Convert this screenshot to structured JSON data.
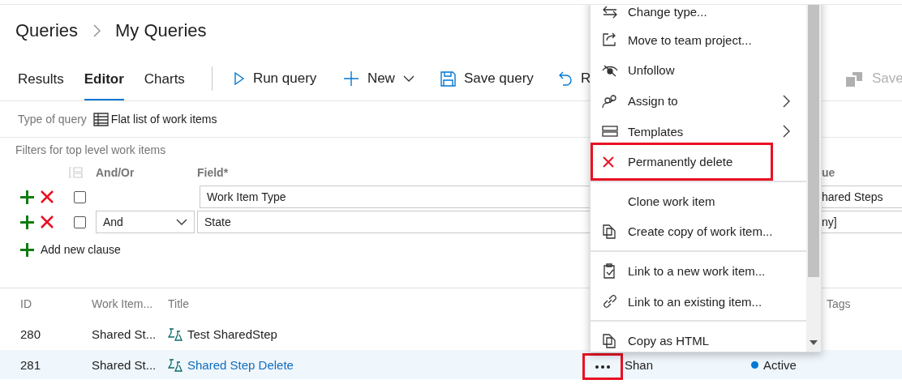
{
  "breadcrumb": [
    "Queries",
    "My Queries"
  ],
  "tabs": [
    {
      "label": "Results",
      "selected": false
    },
    {
      "label": "Editor",
      "selected": true
    },
    {
      "label": "Charts",
      "selected": false
    }
  ],
  "toolbar": [
    {
      "kind": "run",
      "label": "Run query"
    },
    {
      "kind": "new",
      "label": "New"
    },
    {
      "kind": "save",
      "label": "Save query"
    },
    {
      "kind": "revert",
      "label": "R"
    }
  ],
  "toolbar_right": {
    "label": "Save",
    "disabled": true
  },
  "query_type": {
    "label": "Type of query",
    "value": "Flat list of work items"
  },
  "filters": {
    "title": "Filters for top level work items",
    "columns": [
      "And/Or",
      "Field*",
      "ue"
    ],
    "clauses": [
      {
        "checked": false,
        "field": "Work Item Type",
        "value": "hared Steps"
      },
      {
        "checked": false,
        "and_or": "And",
        "field": "State",
        "value": "ny]"
      }
    ],
    "add_label": "Add new clause"
  },
  "results": {
    "columns": [
      "ID",
      "Work Item...",
      "Title",
      "Tags"
    ],
    "rows": [
      {
        "id": "280",
        "type": "Shared St...",
        "title": "Test SharedStep",
        "assigned": "",
        "state": "",
        "selected": false
      },
      {
        "id": "281",
        "type": "Shared St...",
        "title": "Shared Step Delete",
        "assigned": "Shan",
        "state": "Active",
        "color": "#0078d4",
        "selected": true,
        "more_highlighted": true
      }
    ]
  },
  "menu": {
    "items": [
      {
        "kind": "item",
        "label": "Change type...",
        "submenu": false,
        "highlighted": false
      },
      {
        "kind": "item",
        "label": "Move to team project...",
        "submenu": false,
        "highlighted": false
      },
      {
        "kind": "item",
        "label": "Unfollow",
        "submenu": false,
        "highlighted": false
      },
      {
        "kind": "item",
        "label": "Assign to",
        "submenu": true,
        "highlighted": false
      },
      {
        "kind": "item",
        "label": "Templates",
        "submenu": true,
        "highlighted": false
      },
      {
        "kind": "item",
        "label": "Permanently delete",
        "submenu": false,
        "highlighted": true
      },
      {
        "kind": "separator"
      },
      {
        "kind": "item",
        "label": "Clone work item",
        "submenu": false,
        "highlighted": false
      },
      {
        "kind": "item",
        "label": "Create copy of work item...",
        "submenu": false,
        "highlighted": false
      },
      {
        "kind": "separator"
      },
      {
        "kind": "item",
        "label": "Link to a new work item...",
        "submenu": false,
        "highlighted": false
      },
      {
        "kind": "item",
        "label": "Link to an existing item...",
        "submenu": false,
        "highlighted": false
      },
      {
        "kind": "separator"
      },
      {
        "kind": "item",
        "label": "Copy as HTML",
        "submenu": false,
        "highlighted": false
      }
    ]
  }
}
